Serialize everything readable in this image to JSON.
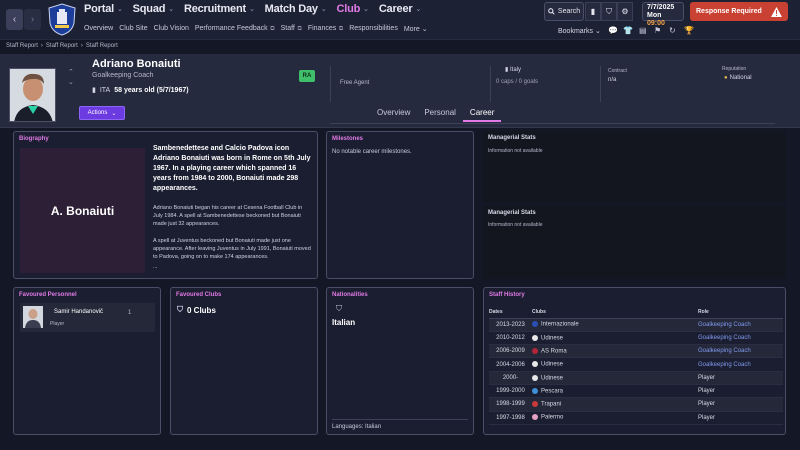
{
  "topbar": {
    "nav_items": [
      {
        "label": "Portal",
        "active": false
      },
      {
        "label": "Squad",
        "active": false
      },
      {
        "label": "Recruitment",
        "active": false
      },
      {
        "label": "Match Day",
        "active": false
      },
      {
        "label": "Club",
        "active": true
      },
      {
        "label": "Career",
        "active": false
      }
    ],
    "sub_items": [
      "Overview",
      "Club Site",
      "Club Vision",
      "Performance Feedback",
      "Staff",
      "Finances",
      "Responsibilities",
      "More"
    ],
    "search_label": "Search",
    "date": "7/7/2025",
    "day": "Mon",
    "time": "09:00",
    "response_label": "Response Required",
    "bookmarks_label": "Bookmarks",
    "accent_color": "#e07be6",
    "alert_color": "#c94133"
  },
  "breadcrumb": [
    "Staff Report",
    "Staff Report",
    "Staff Report"
  ],
  "person": {
    "name": "Adriano Bonaiuti",
    "role": "Goalkeeping Coach",
    "nation_code": "ITA",
    "age_text": "58 years old (5/7/1967)",
    "ca_badge": "RA",
    "status": "Free Agent",
    "nation_name": "Italy",
    "caps": "0 caps / 0 goals",
    "contract_label": "Contract",
    "contract_value": "n/a",
    "reputation_label": "Reputation",
    "reputation_value": "National"
  },
  "actions_label": "Actions",
  "tabs": [
    {
      "label": "Overview",
      "active": false
    },
    {
      "label": "Personal",
      "active": false
    },
    {
      "label": "Career",
      "active": true
    }
  ],
  "biography": {
    "title": "Biography",
    "image_text": "A. Bonaiuti",
    "headline": "Sambenedettese and Calcio Padova icon Adriano Bonaiuti was born in Rome on 5th July 1967. In a playing career which spanned 16 years from 1984 to 2000, Bonaiuti made 298 appearances.",
    "para1": "Adriano Bonaiuti began his career at Cesena Football Club in July 1984. A spell at Sambenedettese beckoned but Bonaiuti made just 32 appearances.",
    "para2": "A spell at Juventus beckoned but Bonaiuti made just one appearance. After leaving Juventus in July 1991, Bonaiuti moved to Padova, going on to make 174 appearances.",
    "ellipsis": "..."
  },
  "milestones": {
    "title": "Milestones",
    "text": "No notable career milestones."
  },
  "managerial_stats_1": {
    "title": "Managerial Stats",
    "text": "Information not available"
  },
  "managerial_stats_2": {
    "title": "Managerial Stats",
    "text": "Information not available"
  },
  "favoured_personnel": {
    "title": "Favoured Personnel",
    "name": "Samir Handanovič",
    "role": "Player",
    "count": "1"
  },
  "favoured_clubs": {
    "title": "Favoured Clubs",
    "text": "0 Clubs"
  },
  "nationalities": {
    "title": "Nationalities",
    "value": "Italian",
    "languages": "Languages: Italian"
  },
  "staff_history": {
    "title": "Staff History",
    "headers": [
      "Dates",
      "Clubs",
      "Role"
    ],
    "rows": [
      {
        "dates": "2013-2023",
        "club": "Internazionale",
        "role": "Goalkeeping Coach",
        "link": true,
        "color": "#2a4fb4"
      },
      {
        "dates": "2010-2012",
        "club": "Udinese",
        "role": "Goalkeeping Coach",
        "link": true,
        "color": "#e8e8e8"
      },
      {
        "dates": "2006-2009",
        "club": "AS Roma",
        "role": "Goalkeeping Coach",
        "link": true,
        "color": "#b3263a"
      },
      {
        "dates": "2004-2006",
        "club": "Udinese",
        "role": "Goalkeeping Coach",
        "link": true,
        "color": "#e8e8e8"
      },
      {
        "dates": "2000-",
        "club": "Udinese",
        "role": "Player",
        "link": false,
        "color": "#e8e8e8"
      },
      {
        "dates": "1999-2000",
        "club": "Pescara",
        "role": "Player",
        "link": false,
        "color": "#3d8fd6"
      },
      {
        "dates": "1998-1999",
        "club": "Trapani",
        "role": "Player",
        "link": false,
        "color": "#c83a3a"
      },
      {
        "dates": "1997-1998",
        "club": "Palermo",
        "role": "Player",
        "link": false,
        "color": "#e6a0c4"
      }
    ]
  }
}
